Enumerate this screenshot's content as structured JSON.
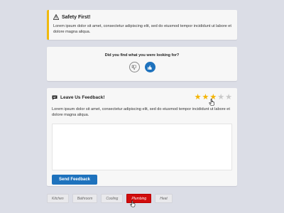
{
  "safety": {
    "title": "Safety First!",
    "body": "Lorem ipsum dolor sit amet, consectetur adipiscing elit, sed do eiusmod tempor incididunt ut labore et dolore magna aliqua.",
    "icon": "warning-icon",
    "accent_color": "#f0b90c"
  },
  "question": {
    "text": "Did you find what you were looking for?",
    "down_icon": "thumbs-down-icon",
    "up_icon": "thumbs-up-icon",
    "selected": "up"
  },
  "feedback": {
    "title": "Leave Us Feedback!",
    "icon": "comment-icon",
    "body": "Lorem ipsum dolor sit amet, consectetur adipiscing elit, sed do eiusmod tempor incididunt ut labore et dolore magna aliqua.",
    "rating": {
      "value": 3,
      "max": 5
    },
    "textarea_value": "",
    "submit_label": "Send Feedback"
  },
  "tags": {
    "items": [
      "Kitchen",
      "Bathroom",
      "Cooling",
      "Plumbing",
      "Heat"
    ],
    "active": "Plumbing",
    "active_color": "#d10d0d"
  },
  "colors": {
    "primary": "#1e72bd",
    "star": "#f4b400",
    "background": "#dbdde6"
  }
}
